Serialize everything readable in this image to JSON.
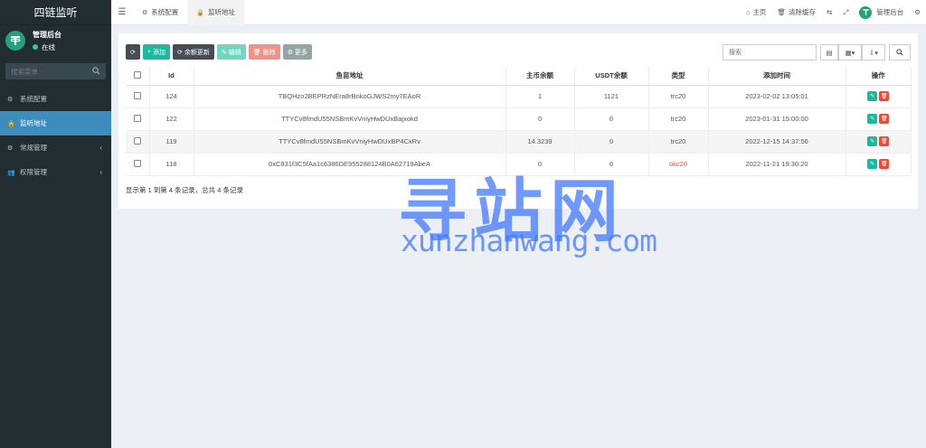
{
  "sidebar": {
    "brand": "四链监听",
    "user_name": "管理后台",
    "user_status": "在线",
    "search_placeholder": "搜索菜单",
    "items": [
      {
        "label": "系统配置",
        "icon": "gear-icon"
      },
      {
        "label": "监听地址",
        "icon": "lock-icon"
      },
      {
        "label": "常规管理",
        "icon": "cogs-icon"
      },
      {
        "label": "权限管理",
        "icon": "users-icon"
      }
    ]
  },
  "topbar": {
    "tabs": [
      {
        "label": "系统配置"
      },
      {
        "label": "监听地址"
      }
    ],
    "home_label": "主页",
    "clear_cache_label": "清除缓存",
    "admin_label": "管理后台"
  },
  "toolbar": {
    "add_label": "添加",
    "refresh_balance_label": "余额更新",
    "edit_label": "编辑",
    "delete_label": "删除",
    "more_label": "更多",
    "search_placeholder": "搜索"
  },
  "table": {
    "headers": [
      "Id",
      "鱼苗地址",
      "主币余额",
      "USDT余额",
      "类型",
      "添加时间",
      "操作"
    ],
    "rows": [
      {
        "id": "124",
        "address": "TBQHzo2BEPRzNEra8rBnkoGJWS2my7EAoR",
        "main_balance": "1",
        "usdt_balance": "1121",
        "type": "trc20",
        "time": "2023-02-02 13:05:01"
      },
      {
        "id": "122",
        "address": "TTYCv8fmdU55NSBmKvVniyHwDUxBajxokd",
        "main_balance": "0",
        "usdt_balance": "0",
        "type": "trc20",
        "time": "2023-01-31 15:00:00"
      },
      {
        "id": "119",
        "address": "TTYCv8fmdU55NSBmKvVniyHwDUxBP4CxRv",
        "main_balance": "14.3239",
        "usdt_balance": "0",
        "type": "trc20",
        "time": "2022-12-15 14:37:56"
      },
      {
        "id": "118",
        "address": "0xC831f3C5fAa1c6386DE955288124B0A62719AbeA",
        "main_balance": "0",
        "usdt_balance": "0",
        "type": "okc20",
        "time": "2022-11-21 19:30:20"
      }
    ],
    "footer": "显示第 1 到第 4 条记录，总共 4 条记录"
  },
  "watermark": {
    "cn": "寻站网",
    "en": "xunzhanwang.com"
  },
  "colors": {
    "sidebar_bg": "#222d32",
    "active_blue": "#3c8dbc",
    "green": "#18bc9c",
    "red": "#e74c3c",
    "tether": "#26a17b"
  }
}
